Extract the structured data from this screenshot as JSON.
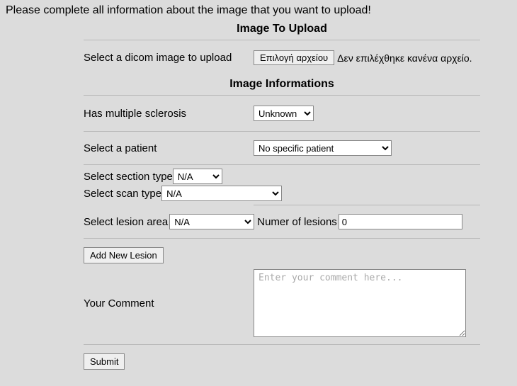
{
  "instruction": "Please complete all information about the image that you want to upload!",
  "sections": {
    "upload_heading": "Image To Upload",
    "info_heading": "Image Informations"
  },
  "upload": {
    "label": "Select a dicom image to upload",
    "button": "Επιλογή αρχείου",
    "status": "Δεν επιλέχθηκε κανένα αρχείο."
  },
  "fields": {
    "sclerosis_label": "Has multiple sclerosis",
    "sclerosis_value": "Unknown",
    "patient_label": "Select a patient",
    "patient_value": "No specific patient",
    "section_label": "Select section type",
    "section_value": "N/A",
    "scan_label": "Select scan type",
    "scan_value": "N/A",
    "lesion_area_label": "Select lesion area",
    "lesion_area_value": "N/A",
    "lesion_count_label": "Numer of lesions",
    "lesion_count_value": "0",
    "add_lesion_button": "Add New Lesion",
    "comment_label": "Your Comment",
    "comment_placeholder": "Enter your comment here...",
    "submit_button": "Submit"
  }
}
